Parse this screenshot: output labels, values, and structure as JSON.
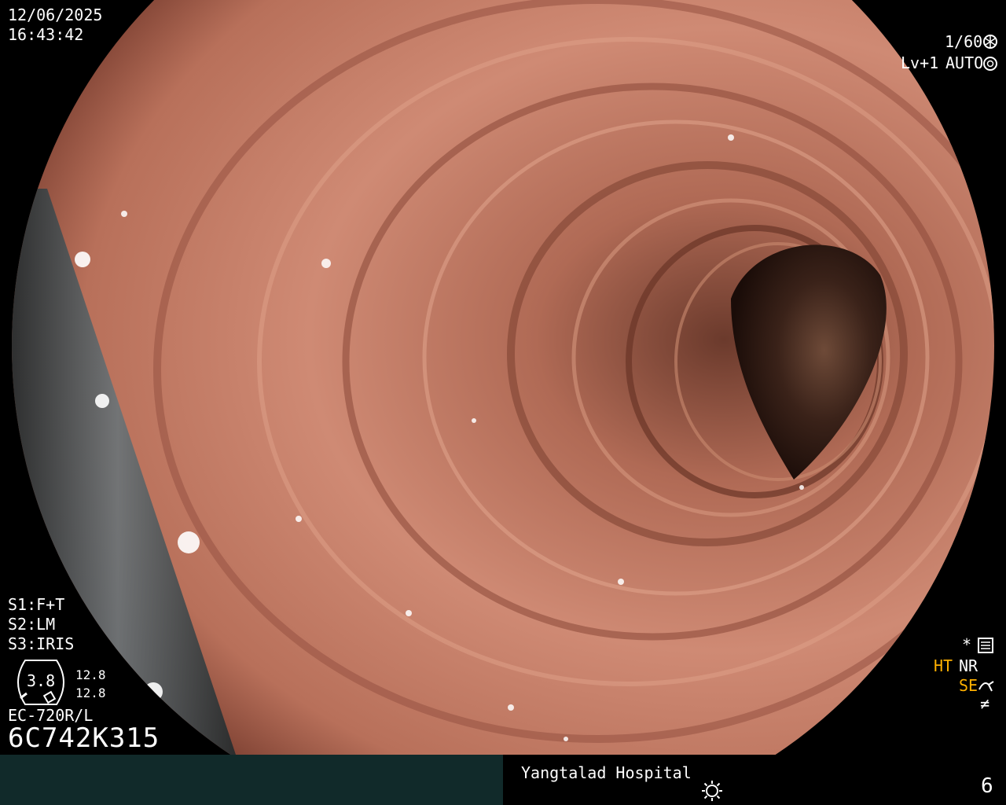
{
  "osd": {
    "date": "12/06/2025",
    "time": "16:43:42",
    "shutter": "1/60",
    "level": "Lv+1",
    "iris_mode": "AUTO",
    "switches": [
      "S1:F+T",
      "S2:LM",
      "S3:IRIS"
    ],
    "gauge_value": "3.8",
    "gauge_side_1": "12.8",
    "gauge_side_2": "12.8",
    "scope_model": "EC-720R/L",
    "scope_serial": "6C742K315",
    "right_marks": {
      "star": "*",
      "ht": "HT",
      "nr": "NR",
      "se": "SE",
      "f": "≠"
    }
  },
  "footer": {
    "hospital": "Yangtalad Hospital",
    "page": "6"
  },
  "colors": {
    "mucosa": "#c27a66",
    "lumen": "#2a1712",
    "amber": "#ffb000",
    "footer_left": "#112a2a"
  },
  "icons": [
    "shutter-icon",
    "iris-icon",
    "settings-icon",
    "enhance-icon",
    "brightness-icon"
  ]
}
